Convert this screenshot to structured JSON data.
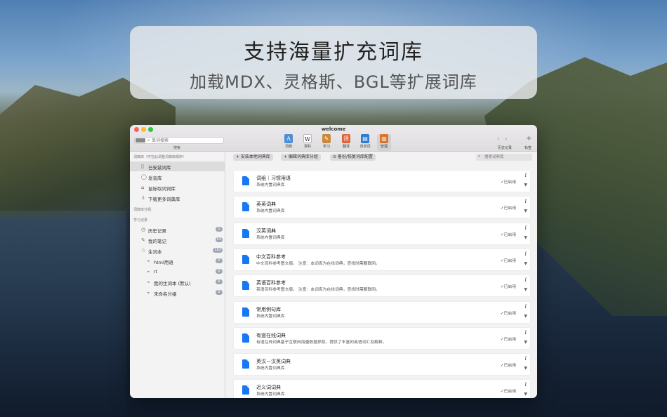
{
  "banner": {
    "title": "支持海量扩充词库",
    "subtitle": "加载MDX、灵格斯、BGL等扩展词库"
  },
  "window": {
    "title": "welcome",
    "search": {
      "placeholder": "单词搜索",
      "label": "搜索"
    },
    "toolbar": [
      {
        "label": "词典",
        "icon": "dictionary-icon",
        "color": "#4a8fd8",
        "glyph": "A"
      },
      {
        "label": "百科",
        "icon": "wikipedia-icon",
        "color": "#ffffff",
        "glyph": "W"
      },
      {
        "label": "学习",
        "icon": "study-icon",
        "color": "#c98a3a",
        "glyph": "✎"
      },
      {
        "label": "翻译",
        "icon": "translate-icon",
        "color": "#e0633a",
        "glyph": "译"
      },
      {
        "label": "背单词",
        "icon": "vocabulary-icon",
        "color": "#2d7fd1",
        "glyph": "▤"
      },
      {
        "label": "管理",
        "icon": "manage-icon",
        "color": "#d9742b",
        "glyph": "▥"
      }
    ],
    "history_label": "历史记录",
    "tag_label": "标签"
  },
  "sidebar": {
    "section_dictionaries": "词典库（可在此调整词典库顺序）",
    "dict_items": [
      {
        "label": "已安装词库",
        "icon": "installed-icon",
        "glyph": "▯"
      },
      {
        "label": "发音库",
        "icon": "speech-icon",
        "glyph": "◯"
      },
      {
        "label": "鼠标取词词库",
        "icon": "mouse-icon",
        "glyph": "⌂"
      },
      {
        "label": "下载更多词典库",
        "icon": "download-icon",
        "glyph": "⇩"
      }
    ],
    "section_groups": "词典库分组",
    "section_study": "学习记录",
    "study_items": [
      {
        "label": "历史记录",
        "icon": "clock-icon",
        "glyph": "◷",
        "badge": "1"
      },
      {
        "label": "我的笔记",
        "icon": "note-icon",
        "glyph": "✎",
        "badge": "43"
      },
      {
        "label": "生词本",
        "icon": "star-icon",
        "glyph": "☆",
        "badge": "102"
      }
    ],
    "wordbook_items": [
      {
        "label": "html用语",
        "badge": "0"
      },
      {
        "label": "rt",
        "badge": "0"
      },
      {
        "label": "我的生词本 (默认)",
        "badge": "0"
      },
      {
        "label": "未命名分组",
        "badge": "0"
      }
    ]
  },
  "main": {
    "actions": [
      "+ 安装本地词典库",
      "+ 编辑词典库分组",
      "⊖ 备份/恢复词库配置"
    ],
    "search_placeholder": "搜索词典库",
    "dictionaries": [
      {
        "name": "词组｜习惯用语",
        "desc": "系统内置词典库",
        "status": "✓已启用"
      },
      {
        "name": "英英词典",
        "desc": "系统内置词典库",
        "status": "✓已启用"
      },
      {
        "name": "汉英词典",
        "desc": "系统内置词典库",
        "status": "✓已启用"
      },
      {
        "name": "中文百科参考",
        "desc": "中文百科参考图文版。 注意：本词库为在线词典，查找时需要联网。",
        "status": "✓已启用"
      },
      {
        "name": "英语百科参考",
        "desc": "英语百科参考图文版。 注意：本词库为在线词典，查找时需要联网。",
        "status": "✓已启用"
      },
      {
        "name": "常用例句库",
        "desc": "系统内置词典库",
        "status": "✓已启用"
      },
      {
        "name": "有道在线词典",
        "desc": "有道在线词典基于互联网海量数据抓取，提供了丰富的英语词汇及解释。",
        "status": "✓已启用"
      },
      {
        "name": "英汉－汉英词典",
        "desc": "系统内置词典库",
        "status": "✓已启用"
      },
      {
        "name": "近义词词典",
        "desc": "系统内置词典库",
        "status": "✓已启用"
      }
    ]
  }
}
